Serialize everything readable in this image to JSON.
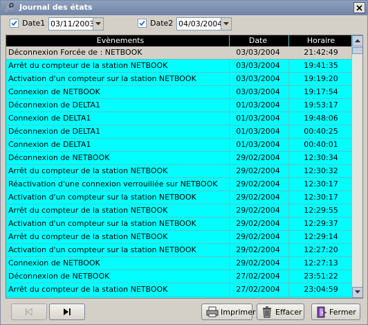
{
  "window": {
    "title": "Journal des états"
  },
  "filters": {
    "date1": {
      "label": "Date1",
      "checked": true,
      "value": "03/11/2003"
    },
    "date2": {
      "label": "Date2",
      "checked": true,
      "value": "04/03/2004"
    }
  },
  "table": {
    "columns": [
      "Evènements",
      "Date",
      "Horaire"
    ],
    "rows": [
      [
        "Déconnexion Forcée de : NETBOOK",
        "03/03/2004",
        "21:42:49"
      ],
      [
        "Arrêt du compteur de la station NETBOOK",
        "03/03/2004",
        "19:41:35"
      ],
      [
        "Activation d'un compteur sur la station NETBOOK",
        "03/03/2004",
        "19:19:20"
      ],
      [
        "Connexion de  NETBOOK",
        "03/03/2004",
        "19:17:54"
      ],
      [
        "Déconnexion de  DELTA1",
        "01/03/2004",
        "19:53:17"
      ],
      [
        "Connexion de  DELTA1",
        "01/03/2004",
        "19:48:06"
      ],
      [
        "Déconnexion de  DELTA1",
        "01/03/2004",
        "00:40:25"
      ],
      [
        "Connexion de  DELTA1",
        "01/03/2004",
        "00:40:01"
      ],
      [
        "Déconnexion de  NETBOOK",
        "29/02/2004",
        "12:30:34"
      ],
      [
        "Arrêt du compteur de la station NETBOOK",
        "29/02/2004",
        "12:30:32"
      ],
      [
        "Réactivation d'une connexion verrouillée sur NETBOOK",
        "29/02/2004",
        "12:30:17"
      ],
      [
        "Activation d'un compteur sur la station NETBOOK",
        "29/02/2004",
        "12:30:17"
      ],
      [
        "Arrêt du compteur de la station NETBOOK",
        "29/02/2004",
        "12:29:55"
      ],
      [
        "Activation d'un compteur sur la station NETBOOK",
        "29/02/2004",
        "12:29:37"
      ],
      [
        "Arrêt du compteur de la station NETBOOK",
        "29/02/2004",
        "12:29:14"
      ],
      [
        "Activation d'un compteur sur la station NETBOOK",
        "29/02/2004",
        "12:27:20"
      ],
      [
        "Connexion de  NETBOOK",
        "29/02/2004",
        "12:27:13"
      ],
      [
        "Déconnexion de  NETBOOK",
        "27/02/2004",
        "23:51:22"
      ],
      [
        "Arrêt du compteur de la station NETBOOK",
        "27/02/2004",
        "23:04:59"
      ]
    ],
    "selected_row": 0
  },
  "buttons": {
    "print": "Imprimer",
    "clear": "Effacer",
    "close": "Fermer"
  },
  "colors": {
    "grid_bg": "#00ffff",
    "header_bg": "#000000",
    "selected_bg": "#d4d0c8"
  },
  "icons": {
    "app": "tools-icon",
    "close": "close-icon",
    "first": "skip-first-icon",
    "last": "skip-last-icon",
    "print": "printer-icon",
    "clear": "trash-icon",
    "exit": "door-exit-icon"
  }
}
